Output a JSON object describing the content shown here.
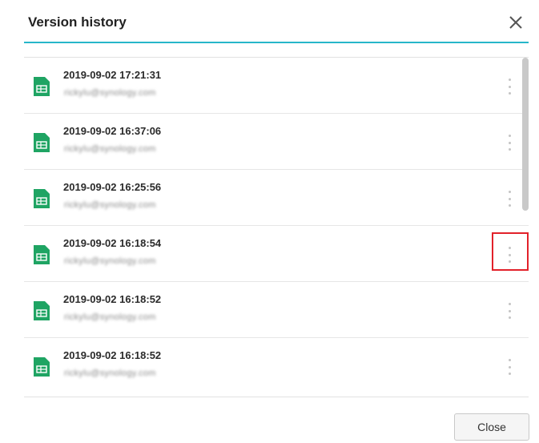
{
  "dialog": {
    "title": "Version history",
    "close_icon": "close-icon",
    "accent_color": "#27b6c9"
  },
  "versions": [
    {
      "timestamp": "2019-09-02 17:21:31",
      "email": "rickylu@synology.com",
      "icon": "spreadsheet-icon"
    },
    {
      "timestamp": "2019-09-02 16:37:06",
      "email": "rickylu@synology.com",
      "icon": "spreadsheet-icon"
    },
    {
      "timestamp": "2019-09-02 16:25:56",
      "email": "rickylu@synology.com",
      "icon": "spreadsheet-icon"
    },
    {
      "timestamp": "2019-09-02 16:18:54",
      "email": "rickylu@synology.com",
      "icon": "spreadsheet-icon"
    },
    {
      "timestamp": "2019-09-02 16:18:52",
      "email": "rickylu@synology.com",
      "icon": "spreadsheet-icon"
    },
    {
      "timestamp": "2019-09-02 16:18:52",
      "email": "rickylu@synology.com",
      "icon": "spreadsheet-icon"
    }
  ],
  "footer": {
    "close_label": "Close"
  },
  "colors": {
    "file_icon": "#1fa463",
    "highlight": "#e2212a"
  }
}
